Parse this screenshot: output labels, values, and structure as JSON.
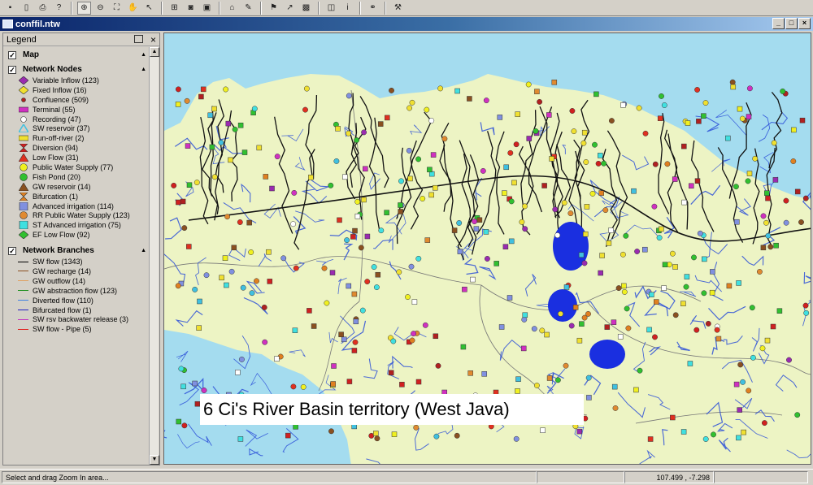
{
  "toolbar": {
    "icons": [
      "save-icon",
      "new-icon",
      "print-icon",
      "help-icon",
      "zoom-in-icon",
      "zoom-out-icon",
      "zoom-extent-icon",
      "pan-icon",
      "select-icon",
      "zoom-window-icon",
      "zoom-layer-icon",
      "zoom-full-icon",
      "node-add-icon",
      "node-edit-icon",
      "flag-icon",
      "branch-icon",
      "map-icon",
      "map-edit-icon",
      "info-icon",
      "link-icon",
      "tools-icon"
    ]
  },
  "window": {
    "title": "conffil.ntw"
  },
  "legend": {
    "title": "Legend",
    "map_label": "Map",
    "nodes": {
      "title": "Network Nodes",
      "items": [
        {
          "label": "Variable Inflow (123)",
          "shape": "diamond",
          "color": "#9a2bb0"
        },
        {
          "label": "Fixed Inflow (16)",
          "shape": "diamond",
          "color": "#f0e030"
        },
        {
          "label": "Confluence (509)",
          "shape": "dot",
          "color": "#b02020"
        },
        {
          "label": "Terminal (55)",
          "shape": "rect",
          "color": "#d030c0"
        },
        {
          "label": "Recording (47)",
          "shape": "circle-open",
          "color": "#ffffff"
        },
        {
          "label": "SW reservoir (37)",
          "shape": "triangle-open",
          "color": "#40c0e0"
        },
        {
          "label": "Run-off-river (2)",
          "shape": "rect",
          "color": "#f0e030"
        },
        {
          "label": "Diversion (94)",
          "shape": "bowtie",
          "color": "#d02020"
        },
        {
          "label": "Low Flow (31)",
          "shape": "triangle",
          "color": "#e03020"
        },
        {
          "label": "Public Water Supply (77)",
          "shape": "circle",
          "color": "#f0f020"
        },
        {
          "label": "Fish Pond (20)",
          "shape": "circle",
          "color": "#30c030"
        },
        {
          "label": "GW reservoir (14)",
          "shape": "triangle",
          "color": "#8a5020"
        },
        {
          "label": "Bifurcation (1)",
          "shape": "bowtie",
          "color": "#e08020"
        },
        {
          "label": "Advanced irrigation (114)",
          "shape": "square",
          "color": "#8090e0"
        },
        {
          "label": "RR Public Water Supply (123)",
          "shape": "circle",
          "color": "#e08a30"
        },
        {
          "label": "ST Advanced irrigation (75)",
          "shape": "square",
          "color": "#40e0e0"
        },
        {
          "label": "EF Low Flow (92)",
          "shape": "diamond",
          "color": "#30c030"
        }
      ]
    },
    "branches": {
      "title": "Network Branches",
      "items": [
        {
          "label": "SW flow (1343)",
          "color": "#000000"
        },
        {
          "label": "GW recharge (14)",
          "color": "#8a5020"
        },
        {
          "label": "GW outflow (14)",
          "color": "#e0a060"
        },
        {
          "label": "GW abstraction flow (123)",
          "color": "#209020"
        },
        {
          "label": "Diverted flow (110)",
          "color": "#4080e0"
        },
        {
          "label": "Bifurcated flow (1)",
          "color": "#2020c0"
        },
        {
          "label": "SW rsv backwater release (3)",
          "color": "#c030c0"
        },
        {
          "label": "SW flow - Pipe (5)",
          "color": "#e02020"
        }
      ]
    }
  },
  "map": {
    "caption": "6 Ci's River Basin territory (West Java)",
    "colors": {
      "sea": "#a4dcef",
      "land": "#edf4c4",
      "river": "#2c4fd8",
      "reservoir": "#1a2fe0"
    }
  },
  "status": {
    "message": "Select and drag Zoom In area...",
    "coordinates": "107.499 , -7.298"
  }
}
